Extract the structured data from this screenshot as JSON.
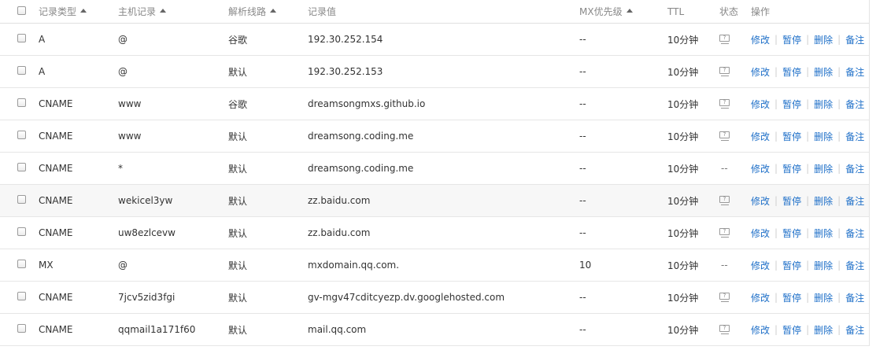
{
  "header": {
    "type": "记录类型",
    "host": "主机记录",
    "line": "解析线路",
    "value": "记录值",
    "mx": "MX优先级",
    "ttl": "TTL",
    "status": "状态",
    "ops": "操作"
  },
  "ops_labels": {
    "edit": "修改",
    "pause": "暂停",
    "delete": "删除",
    "note": "备注",
    "sep": "|"
  },
  "rows": [
    {
      "type": "A",
      "host": "@",
      "line": "谷歌",
      "value": "192.30.252.154",
      "mx": "--",
      "ttl": "10分钟",
      "status": "icon"
    },
    {
      "type": "A",
      "host": "@",
      "line": "默认",
      "value": "192.30.252.153",
      "mx": "--",
      "ttl": "10分钟",
      "status": "icon"
    },
    {
      "type": "CNAME",
      "host": "www",
      "line": "谷歌",
      "value": "dreamsongmxs.github.io",
      "mx": "--",
      "ttl": "10分钟",
      "status": "icon"
    },
    {
      "type": "CNAME",
      "host": "www",
      "line": "默认",
      "value": "dreamsong.coding.me",
      "mx": "--",
      "ttl": "10分钟",
      "status": "icon"
    },
    {
      "type": "CNAME",
      "host": "*",
      "line": "默认",
      "value": "dreamsong.coding.me",
      "mx": "--",
      "ttl": "10分钟",
      "status": "--"
    },
    {
      "type": "CNAME",
      "host": "wekicel3yw",
      "line": "默认",
      "value": "zz.baidu.com",
      "mx": "--",
      "ttl": "10分钟",
      "status": "icon"
    },
    {
      "type": "CNAME",
      "host": "uw8ezlcevw",
      "line": "默认",
      "value": "zz.baidu.com",
      "mx": "--",
      "ttl": "10分钟",
      "status": "icon"
    },
    {
      "type": "MX",
      "host": "@",
      "line": "默认",
      "value": "mxdomain.qq.com.",
      "mx": "10",
      "ttl": "10分钟",
      "status": "--"
    },
    {
      "type": "CNAME",
      "host": "7jcv5zid3fgi",
      "line": "默认",
      "value": "gv-mgv47cditcyezp.dv.googlehosted.com",
      "mx": "--",
      "ttl": "10分钟",
      "status": "icon"
    },
    {
      "type": "CNAME",
      "host": "qqmail1a171f60",
      "line": "默认",
      "value": "mail.qq.com",
      "mx": "--",
      "ttl": "10分钟",
      "status": "icon"
    }
  ],
  "highlighted_row": 5,
  "colors": {
    "link": "#1e6fc8",
    "header_text": "#888888",
    "row_highlight": "#f7f7f7"
  },
  "icons": {
    "sort": "sort-asc-icon",
    "status": "status-tooltip-icon",
    "checkbox": "checkbox-icon"
  }
}
